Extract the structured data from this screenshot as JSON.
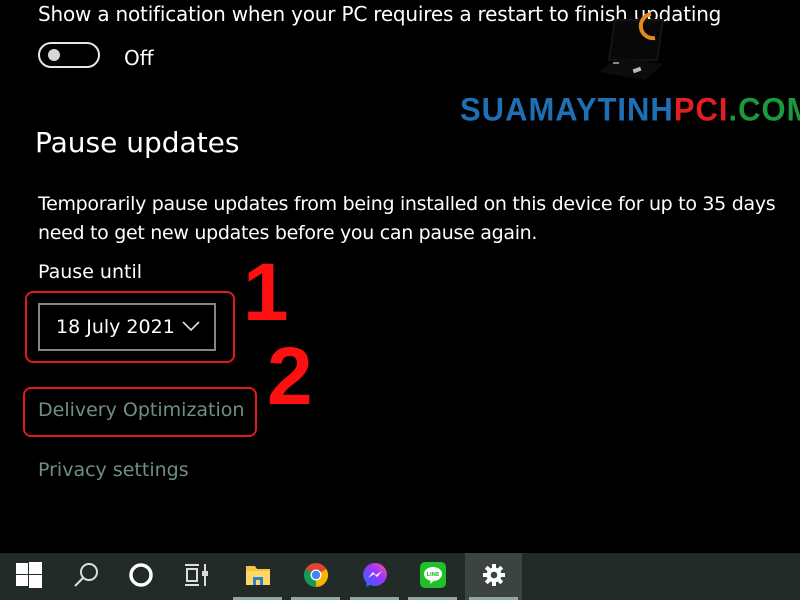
{
  "restart_notification": {
    "text": "Show a notification when your PC requires a restart to finish updating",
    "toggle_state": "Off",
    "toggle_on": false
  },
  "pause_updates": {
    "title": "Pause updates",
    "description_line1": "Temporarily pause updates from being installed on this device for up to 35 days",
    "description_line2": "need to get new updates before you can pause again.",
    "pause_until_label": "Pause until",
    "pause_until_value": "18 July 2021"
  },
  "links": {
    "delivery_optimization": "Delivery Optimization",
    "privacy_settings": "Privacy settings"
  },
  "annotations": {
    "step1": "1",
    "step2": "2",
    "highlight_color": "#e11b1b"
  },
  "watermark": {
    "part1": "SUAMAYTINH",
    "part2": "PCI",
    "part3": ".COM",
    "color1": "#1f6fb5",
    "color2": "#e02020",
    "color3": "#1a9a3c"
  },
  "taskbar": {
    "items": [
      {
        "name": "start",
        "icon": "windows-logo-icon"
      },
      {
        "name": "search",
        "icon": "search-icon"
      },
      {
        "name": "cortana",
        "icon": "cortana-circle-icon"
      },
      {
        "name": "task-view",
        "icon": "task-view-icon"
      },
      {
        "name": "file-explorer",
        "icon": "folder-icon",
        "running": true
      },
      {
        "name": "chrome",
        "icon": "chrome-icon",
        "running": true
      },
      {
        "name": "messenger",
        "icon": "messenger-icon",
        "running": true
      },
      {
        "name": "line",
        "icon": "line-icon",
        "running": true,
        "label": "LINE"
      },
      {
        "name": "settings",
        "icon": "gear-icon",
        "running": true,
        "active": true
      }
    ]
  }
}
